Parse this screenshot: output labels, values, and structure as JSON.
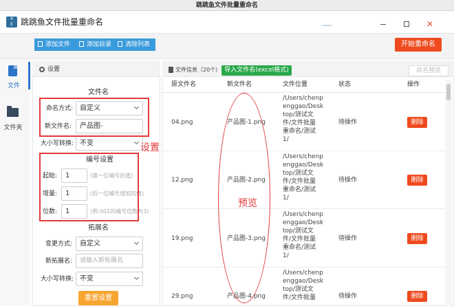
{
  "window": {
    "title": "跳跳鱼文件批量重命名"
  },
  "app": {
    "logo_text": "X\nE",
    "title": "跳跳鱼文件批量重命名"
  },
  "toolbar": {
    "add_file": "添加文件",
    "add_dir": "添加目录",
    "clear_list": "清除列表",
    "start_rename": "开始重命名"
  },
  "nav": {
    "file": "文件",
    "folder": "文件夹"
  },
  "settings": {
    "title": "设置",
    "filename": {
      "title": "文件名",
      "mode_label": "命名方式:",
      "mode_value": "自定义",
      "name_label": "新文件名:",
      "name_value": "产品图-"
    },
    "case": {
      "label": "大小写转换:",
      "value": "不变"
    },
    "numbering": {
      "title": "编号设置",
      "start_label": "起始:",
      "start_value": "1",
      "start_hint": "(第一位编号的值)",
      "step_label": "增量:",
      "step_value": "1",
      "step_hint": "(后一位编号增加的值)",
      "digits_label": "位数:",
      "digits_value": "1",
      "digits_hint": "(例:001的编号位数为3)"
    },
    "extension": {
      "title": "拓展名",
      "mode_label": "变更方式:",
      "mode_value": "自定义",
      "new_label": "新拓展名:",
      "new_placeholder": "请输入新拓展名",
      "case_label": "大小写转换:",
      "case_value": "不变"
    },
    "reset": "重置设置"
  },
  "annotations": {
    "settings": "设置",
    "preview": "预览"
  },
  "fileinfo": {
    "title": "文件信息（20个）",
    "import_btn": "导入文件名(excel格式)",
    "preview_btn": "命名预览",
    "columns": [
      "原文件名",
      "新文件名",
      "文件位置",
      "状态",
      "操作"
    ],
    "rows": [
      {
        "orig": "04.png",
        "new": "产品图-1.png",
        "path": "/Users/chenp\nenggao/Desk\ntop/测试文\n件/文件批量\n重命名/测试\n1/",
        "status": "待操作",
        "action": "删除"
      },
      {
        "orig": "12.png",
        "new": "产品图-2.png",
        "path": "/Users/chenp\nenggao/Desk\ntop/测试文\n件/文件批量\n重命名/测试\n1/",
        "status": "待操作",
        "action": "删除"
      },
      {
        "orig": "19.png",
        "new": "产品图-3.png",
        "path": "/Users/chenp\nenggao/Desk\ntop/测试文\n件/文件批量\n重命名/测试\n1/",
        "status": "待操作",
        "action": "删除"
      },
      {
        "orig": "29.png",
        "new": "产品图-4.png",
        "path": "/Users/chenp\nenggao/Desk\ntop/测试文\n件/文件批量",
        "status": "待操作",
        "action": "删除"
      }
    ]
  }
}
